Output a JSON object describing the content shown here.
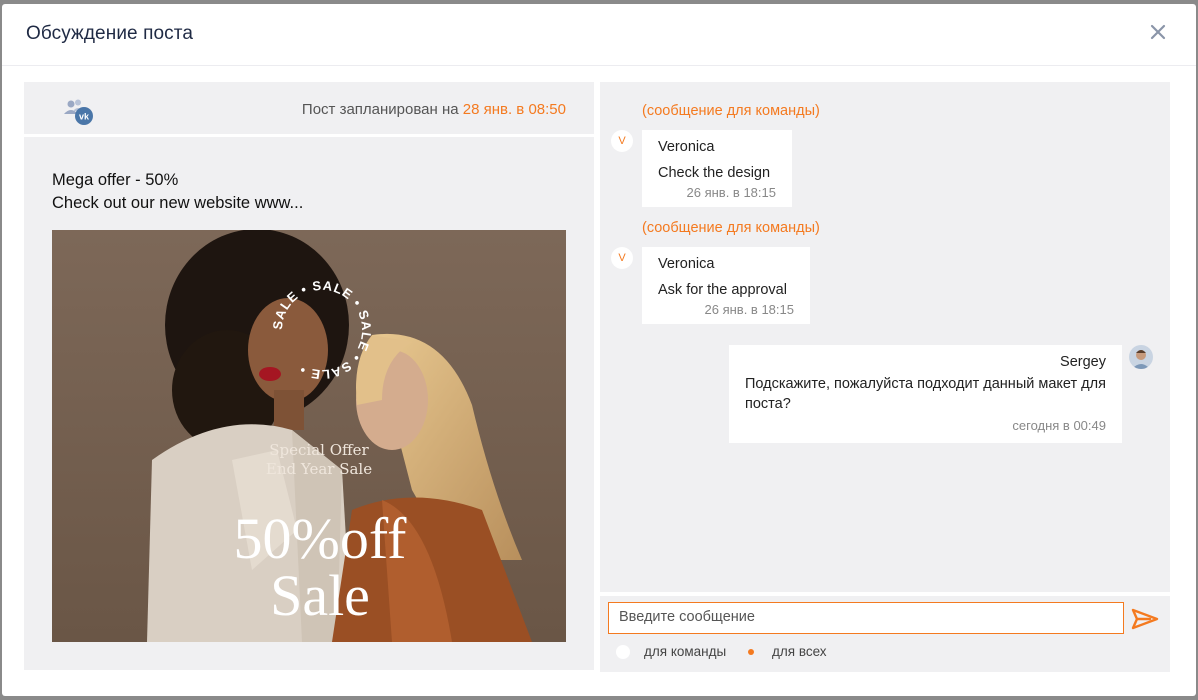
{
  "modal": {
    "title": "Обсуждение поста"
  },
  "post": {
    "network_icon": "vk-users-icon",
    "schedule_prefix": "Пост запланирован на",
    "schedule_date": "28 янв. в 08:50",
    "text_line1": "Mega offer - 50%",
    "text_line2": "Check out our new website www...",
    "image": {
      "badge_word": "SALE",
      "subtitle_line1": "Special Offer",
      "subtitle_line2": "End Year Sale",
      "headline_line1": "50%off",
      "headline_line2": "Sale"
    }
  },
  "chat": {
    "messages": [
      {
        "label": "(сообщение для команды)",
        "avatar_letter": "V",
        "author": "Veronica",
        "body": "Check the design",
        "time": "26 янв. в 18:15"
      },
      {
        "label": "(сообщение для команды)",
        "avatar_letter": "V",
        "author": "Veronica",
        "body": "Ask for the approval",
        "time": "26 янв. в 18:15"
      },
      {
        "author": "Sergey",
        "body": "Подскажите, пожалуйста подходит данный макет для поста?",
        "time": "сегодня в 00:49"
      }
    ]
  },
  "composer": {
    "placeholder": "Введите сообщение",
    "radio_team": "для команды",
    "radio_all": "для всех",
    "selected": "для всех"
  },
  "colors": {
    "accent": "#f47a20",
    "panel_bg": "#f0f0f2",
    "title": "#1f2a44"
  }
}
